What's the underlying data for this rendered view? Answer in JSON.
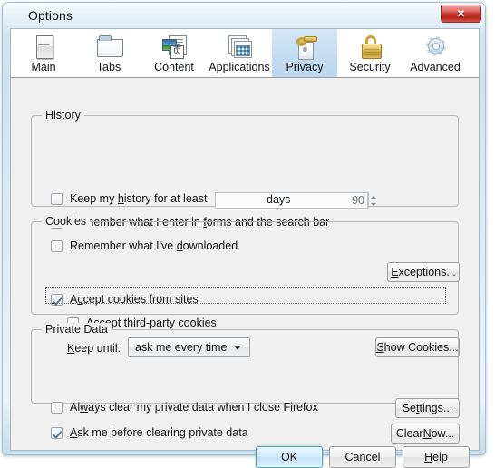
{
  "window": {
    "title": "Options",
    "close_label": "✕"
  },
  "tabs": [
    {
      "label": "Main",
      "icon": "browser-window-icon",
      "selected": false
    },
    {
      "label": "Tabs",
      "icon": "tab-folder-icon",
      "selected": false
    },
    {
      "label": "Content",
      "icon": "content-page-icon",
      "selected": false
    },
    {
      "label": "Applications",
      "icon": "applications-icon",
      "selected": false
    },
    {
      "label": "Privacy",
      "icon": "privacy-door-icon",
      "selected": true
    },
    {
      "label": "Security",
      "icon": "padlock-icon",
      "selected": false
    },
    {
      "label": "Advanced",
      "icon": "gear-icon",
      "selected": false
    }
  ],
  "history": {
    "group_title": "History",
    "keep_history": {
      "label_before": "Keep my ",
      "accel": "h",
      "label_after": "istory for at least",
      "checked": false
    },
    "days_value": "90",
    "days_label": "days",
    "remember_forms": {
      "label_before": "Remember what I enter in ",
      "accel": "f",
      "label_after": "orms and the search bar",
      "checked": false
    },
    "remember_downloads": {
      "label_before": "Remember what I've ",
      "accel": "d",
      "label_after": "ownloaded",
      "checked": false
    }
  },
  "cookies": {
    "group_title": "Cookies",
    "accept_cookies": {
      "label_before": "A",
      "accel": "c",
      "label_after": "cept cookies from sites",
      "checked": true
    },
    "accept_third_party": {
      "label_before": "Accept third-party cookies",
      "accel": "",
      "label_after": "",
      "checked": false
    },
    "keep_until_label_before": "",
    "keep_until_accel": "K",
    "keep_until_label_after": "eep until:",
    "keep_until_value": "ask me every time",
    "exceptions_button": {
      "label_before": "",
      "accel": "E",
      "label_after": "xceptions..."
    },
    "show_cookies_button": {
      "label_before": "",
      "accel": "S",
      "label_after": "how Cookies..."
    }
  },
  "private_data": {
    "group_title": "Private Data",
    "always_clear": {
      "label_before": "Al",
      "accel": "w",
      "label_after": "ays clear my private data when I close Firefox",
      "checked": false
    },
    "ask_before_clearing": {
      "label_before": "",
      "accel": "A",
      "label_after": "sk me before clearing private data",
      "checked": true
    },
    "settings_button": {
      "label_before": "Se",
      "accel": "t",
      "label_after": "tings..."
    },
    "clear_now_button": {
      "label_before": "Clear ",
      "accel": "N",
      "label_after": "ow..."
    }
  },
  "dialog_buttons": {
    "ok": {
      "label_before": "OK",
      "accel": "",
      "label_after": ""
    },
    "cancel": {
      "label_before": "Cancel",
      "accel": "",
      "label_after": ""
    },
    "help": {
      "label_before": "",
      "accel": "H",
      "label_after": "elp"
    }
  },
  "colors": {
    "frame": "#cfe2f0",
    "panel": "#f0f0f0",
    "selected_tab": "#c3dbf2",
    "close_button": "#c53127",
    "default_button_border": "#4c9fd0",
    "checkmark": "#5a7a94"
  }
}
